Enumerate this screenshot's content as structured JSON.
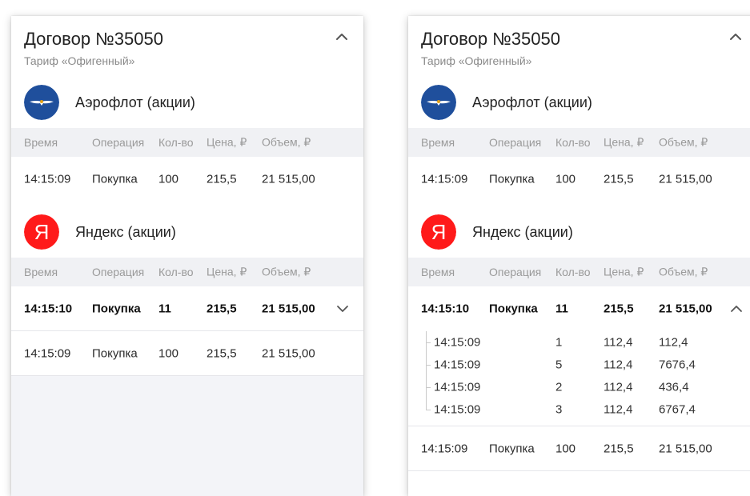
{
  "contract": {
    "title": "Договор №35050",
    "tariff": "Тариф «Офигенный»"
  },
  "columns": {
    "time": "Время",
    "operation": "Операция",
    "qty": "Кол-во",
    "price": "Цена, ₽",
    "volume": "Объем, ₽"
  },
  "aeroflot": {
    "name": "Аэрофлот (акции)",
    "row": {
      "time": "14:15:09",
      "op": "Покупка",
      "qty": "100",
      "price": "215,5",
      "volume": "21 515,00"
    }
  },
  "yandex": {
    "name": "Яндекс (акции)",
    "logo_letter": "Я",
    "main_row": {
      "time": "14:15:10",
      "op": "Покупка",
      "qty": "11",
      "price": "215,5",
      "volume": "21 515,00"
    },
    "sub_rows": [
      {
        "time": "14:15:09",
        "qty": "1",
        "price": "112,4",
        "volume": "112,4"
      },
      {
        "time": "14:15:09",
        "qty": "5",
        "price": "112,4",
        "volume": "7676,4"
      },
      {
        "time": "14:15:09",
        "qty": "2",
        "price": "112,4",
        "volume": "436,4"
      },
      {
        "time": "14:15:09",
        "qty": "3",
        "price": "112,4",
        "volume": "6767,4"
      }
    ],
    "last_row": {
      "time": "14:15:09",
      "op": "Покупка",
      "qty": "100",
      "price": "215,5",
      "volume": "21 515,00"
    }
  },
  "colors": {
    "aeroflot_blue": "#1f4f9c",
    "yandex_red": "#ff1a1a",
    "header_bg": "#f0f1f4"
  },
  "icons": {
    "collapse": "chevron-up-icon",
    "expand": "chevron-down-icon"
  }
}
